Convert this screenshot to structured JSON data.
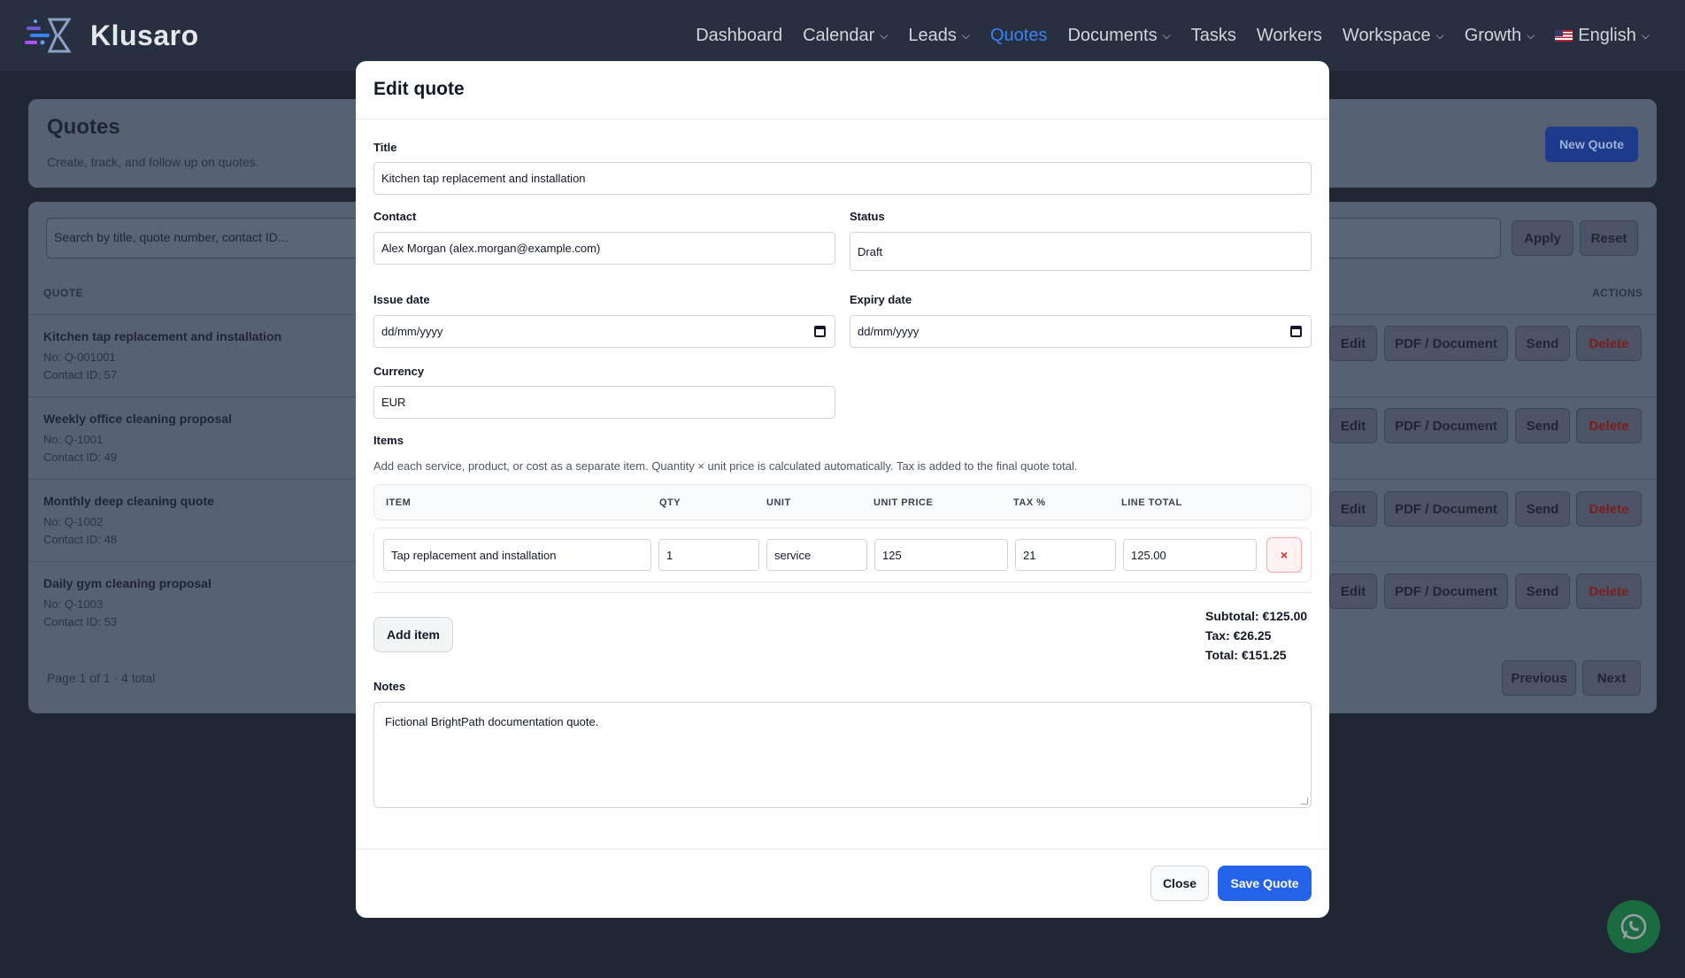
{
  "app": {
    "brand": "Klusaro",
    "nav": [
      {
        "label": "Dashboard",
        "dropdown": false,
        "active": false
      },
      {
        "label": "Calendar",
        "dropdown": true,
        "active": false
      },
      {
        "label": "Leads",
        "dropdown": true,
        "active": false
      },
      {
        "label": "Quotes",
        "dropdown": false,
        "active": true
      },
      {
        "label": "Documents",
        "dropdown": true,
        "active": false
      },
      {
        "label": "Tasks",
        "dropdown": false,
        "active": false
      },
      {
        "label": "Workers",
        "dropdown": false,
        "active": false
      },
      {
        "label": "Workspace",
        "dropdown": true,
        "active": false
      },
      {
        "label": "Growth",
        "dropdown": true,
        "active": false
      }
    ],
    "language": "English",
    "accent": "#3b82f6"
  },
  "page": {
    "title": "Quotes",
    "subtitle": "Create, track, and follow up on quotes.",
    "new_quote": "New Quote",
    "search_placeholder": "Search by title, quote number, contact ID...",
    "apply": "Apply",
    "reset": "Reset",
    "col_quote": "QUOTE",
    "col_actions": "ACTIONS",
    "rows": [
      {
        "title": "Kitchen tap replacement and installation",
        "number": "No: Q-001001",
        "contact": "Contact ID: 57"
      },
      {
        "title": "Weekly office cleaning proposal",
        "number": "No: Q-1001",
        "contact": "Contact ID: 49"
      },
      {
        "title": "Monthly deep cleaning quote",
        "number": "No: Q-1002",
        "contact": "Contact ID: 48"
      },
      {
        "title": "Daily gym cleaning proposal",
        "number": "No: Q-1003",
        "contact": "Contact ID: 53"
      }
    ],
    "actions": {
      "edit": "Edit",
      "pdf": "PDF / Document",
      "send": "Send",
      "delete": "Delete"
    },
    "pagination": {
      "info": "Page 1 of 1 · 4 total",
      "previous": "Previous",
      "next": "Next"
    }
  },
  "modal": {
    "title": "Edit quote",
    "title_label": "Title",
    "title_value": "Kitchen tap replacement and installation",
    "contact_label": "Contact",
    "contact_value": "Alex Morgan (alex.morgan@example.com)",
    "status_label": "Status",
    "status_value": "Draft",
    "issue_label": "Issue date",
    "issue_value": "dd/mm/yyyy",
    "expiry_label": "Expiry date",
    "expiry_value": "dd/mm/yyyy",
    "currency_label": "Currency",
    "currency_value": "EUR",
    "items_label": "Items",
    "items_hint": "Add each service, product, or cost as a separate item. Quantity × unit price is calculated automatically. Tax is added to the final quote total.",
    "items_cols": {
      "item": "ITEM",
      "qty": "QTY",
      "unit": "UNIT",
      "unit_price": "UNIT PRICE",
      "tax": "TAX %",
      "line_total": "LINE TOTAL"
    },
    "item": {
      "name": "Tap replacement and installation",
      "qty": "1",
      "unit": "service",
      "unit_price": "125",
      "tax": "21",
      "line_total": "125.00"
    },
    "remove_glyph": "×",
    "add_item": "Add item",
    "subtotal": "Subtotal: €125.00",
    "tax": "Tax: €26.25",
    "total": "Total: €151.25",
    "notes_label": "Notes",
    "notes_value": "Fictional BrightPath documentation quote.",
    "close": "Close",
    "save": "Save Quote"
  }
}
